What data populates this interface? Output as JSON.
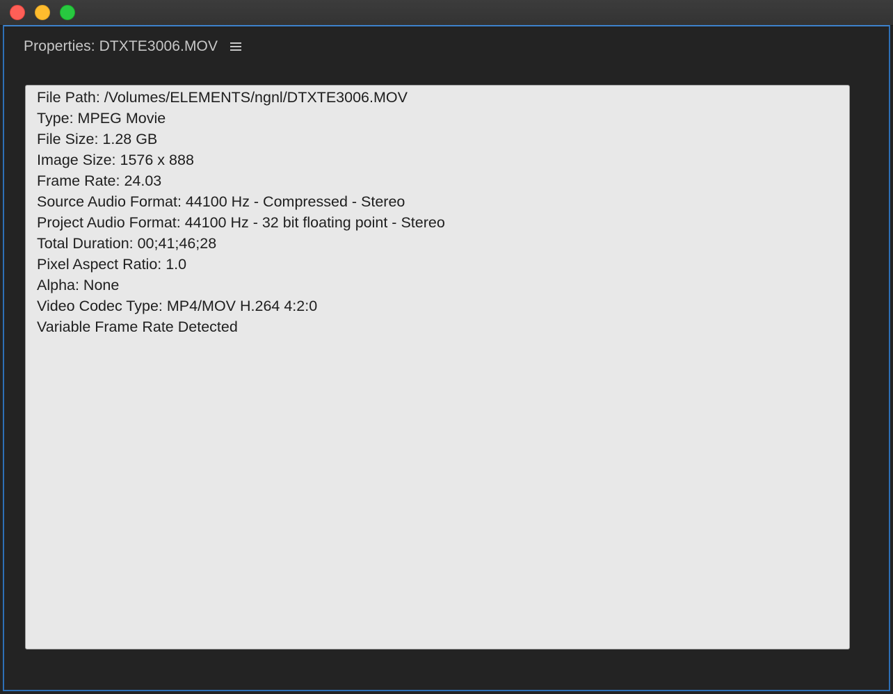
{
  "window": {
    "controls": {
      "close": "close",
      "minimize": "minimize",
      "zoom": "zoom"
    }
  },
  "panel": {
    "title": "Properties: DTXTE3006.MOV",
    "menu_icon": "hamburger-menu-icon"
  },
  "properties": [
    "File Path: /Volumes/ELEMENTS/ngnl/DTXTE3006.MOV",
    "Type: MPEG Movie",
    "File Size: 1.28 GB",
    "Image Size: 1576 x 888",
    "Frame Rate: 24.03",
    "Source Audio Format: 44100 Hz - Compressed - Stereo",
    "Project Audio Format: 44100 Hz - 32 bit floating point - Stereo",
    "Total Duration: 00;41;46;28",
    "Pixel Aspect Ratio: 1.0",
    "Alpha: None",
    "Video Codec Type: MP4/MOV H.264 4:2:0",
    "Variable Frame Rate Detected"
  ],
  "colors": {
    "accent_border": "#2d6fb6",
    "panel_bg": "#232323",
    "content_bg": "#e8e8e8",
    "close": "#fe5f57",
    "minimize": "#febc2e",
    "zoom": "#28c840"
  }
}
